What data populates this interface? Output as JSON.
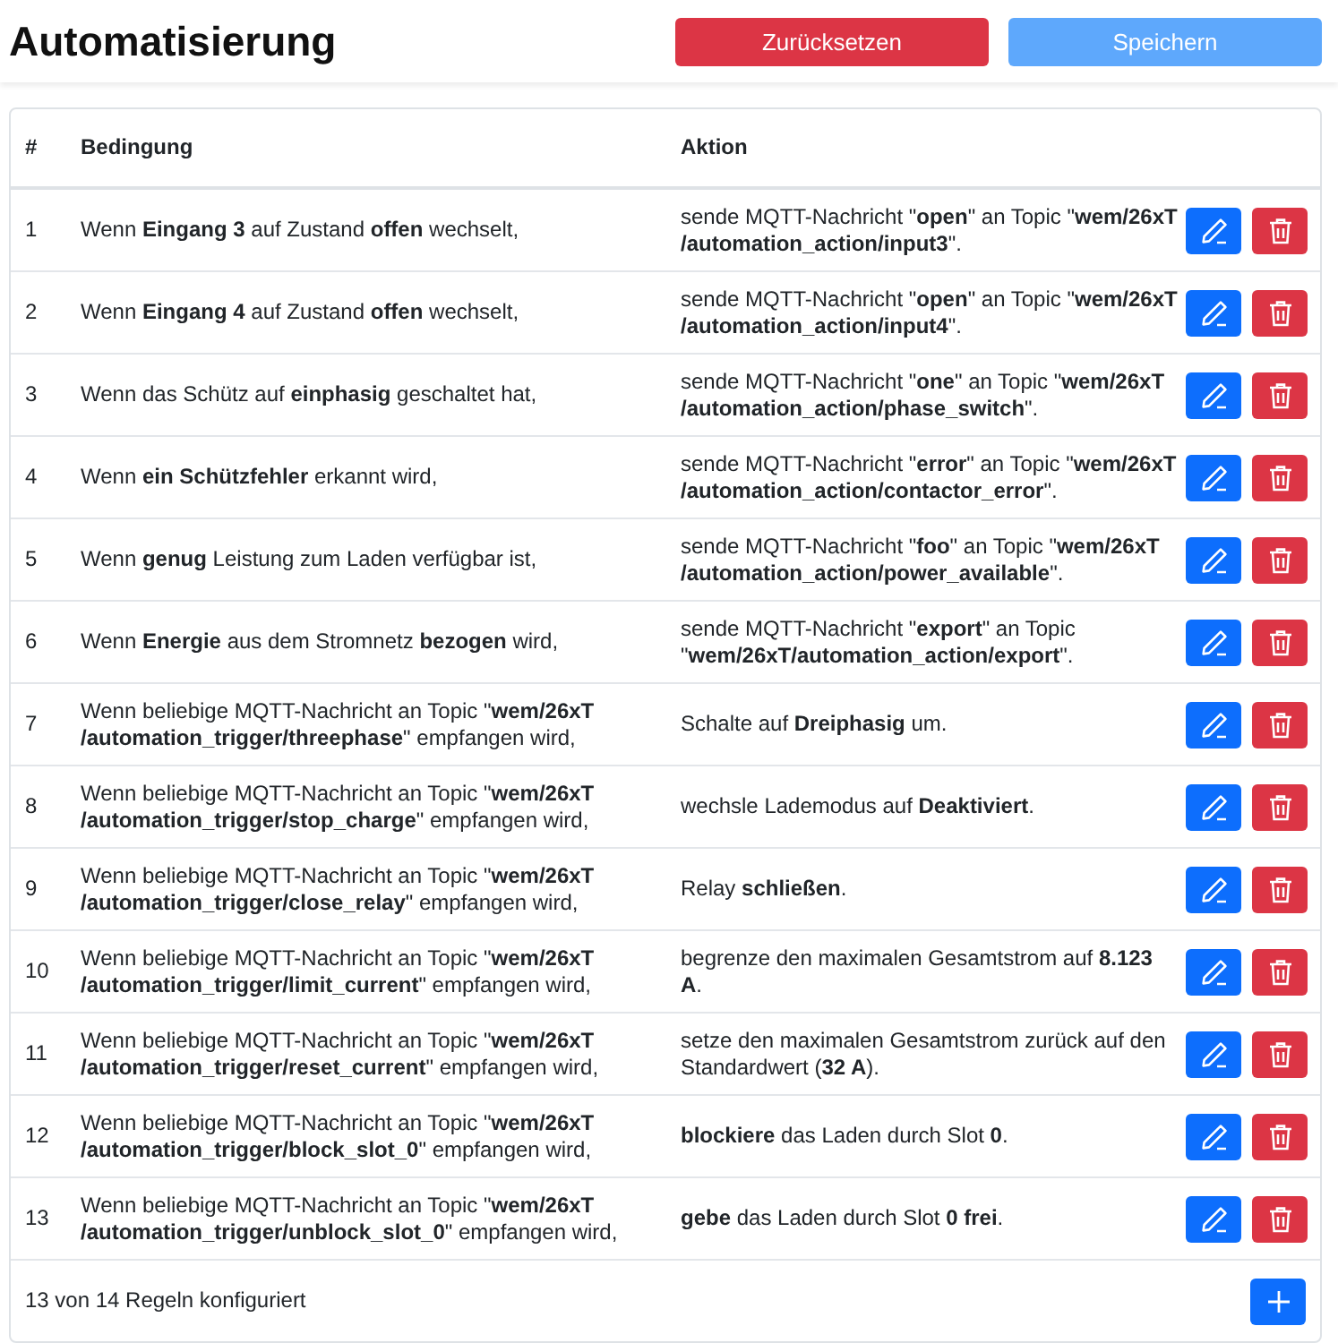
{
  "title": "Automatisierung",
  "buttons": [
    {
      "label": "Zurücksetzen",
      "kind": "danger",
      "disabled": false
    },
    {
      "label": "Speichern",
      "kind": "primary",
      "disabled": true
    }
  ],
  "table": {
    "columns": [
      "#",
      "Bedingung",
      "Aktion"
    ],
    "rows": [
      {
        "index": "1",
        "condition": [
          "Wenn **Eingang 3** auf Zustand **offen** wechselt,"
        ],
        "action": [
          "sende MQTT-Nachricht \"**open**\" an Topic \"**wem/26xT**",
          "**/automation_action/input3**\"."
        ]
      },
      {
        "index": "2",
        "condition": [
          "Wenn **Eingang 4** auf Zustand **offen** wechselt,"
        ],
        "action": [
          "sende MQTT-Nachricht \"**open**\" an Topic \"**wem/26xT**",
          "**/automation_action/input4**\"."
        ]
      },
      {
        "index": "3",
        "condition": [
          "Wenn das Schütz auf **einphasig** geschaltet hat,"
        ],
        "action": [
          "sende MQTT-Nachricht \"**one**\" an Topic \"**wem/26xT**",
          "**/automation_action/phase_switch**\"."
        ]
      },
      {
        "index": "4",
        "condition": [
          "Wenn **ein Schützfehler** erkannt wird,"
        ],
        "action": [
          "sende MQTT-Nachricht \"**error**\" an Topic \"**wem/26xT**",
          "**/automation_action/contactor_error**\"."
        ]
      },
      {
        "index": "5",
        "condition": [
          "Wenn **genug** Leistung zum Laden verfügbar ist,"
        ],
        "action": [
          "sende MQTT-Nachricht \"**foo**\" an Topic \"**wem/26xT**",
          "**/automation_action/power_available**\"."
        ]
      },
      {
        "index": "6",
        "condition": [
          "Wenn **Energie** aus dem Stromnetz **bezogen** wird,"
        ],
        "action": [
          "sende MQTT-Nachricht \"**export**\" an Topic",
          "\"**wem/26xT/automation_action/export**\"."
        ]
      },
      {
        "index": "7",
        "condition": [
          "Wenn beliebige MQTT-Nachricht an Topic \"**wem/26xT**",
          "**/automation_trigger/threephase**\" empfangen wird,"
        ],
        "action": [
          "Schalte auf **Dreiphasig** um."
        ]
      },
      {
        "index": "8",
        "condition": [
          "Wenn beliebige MQTT-Nachricht an Topic \"**wem/26xT**",
          "**/automation_trigger/stop_charge**\" empfangen wird,"
        ],
        "action": [
          "wechsle Lademodus auf **Deaktiviert**."
        ]
      },
      {
        "index": "9",
        "condition": [
          "Wenn beliebige MQTT-Nachricht an Topic \"**wem/26xT**",
          "**/automation_trigger/close_relay**\" empfangen wird,"
        ],
        "action": [
          "Relay **schließen**."
        ]
      },
      {
        "index": "10",
        "condition": [
          "Wenn beliebige MQTT-Nachricht an Topic \"**wem/26xT**",
          "**/automation_trigger/limit_current**\" empfangen wird,"
        ],
        "action": [
          "begrenze den maximalen Gesamtstrom auf **8.123**",
          "**A**."
        ]
      },
      {
        "index": "11",
        "condition": [
          "Wenn beliebige MQTT-Nachricht an Topic \"**wem/26xT**",
          "**/automation_trigger/reset_current**\" empfangen wird,"
        ],
        "action": [
          "setze den maximalen Gesamtstrom zurück auf den",
          "Standardwert (**32 A**)."
        ]
      },
      {
        "index": "12",
        "condition": [
          "Wenn beliebige MQTT-Nachricht an Topic \"**wem/26xT**",
          "**/automation_trigger/block_slot_0**\" empfangen wird,"
        ],
        "action": [
          "**blockiere** das Laden durch Slot **0**."
        ]
      },
      {
        "index": "13",
        "condition": [
          "Wenn beliebige MQTT-Nachricht an Topic \"**wem/26xT**",
          "**/automation_trigger/unblock_slot_0**\" empfangen wird,"
        ],
        "action": [
          "**gebe** das Laden durch Slot **0 frei**."
        ]
      }
    ]
  },
  "footer": {
    "summary": "13 von 14 Regeln konfiguriert"
  }
}
